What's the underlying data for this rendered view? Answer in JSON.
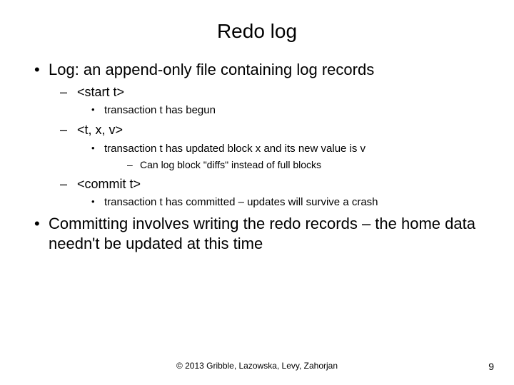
{
  "title": "Redo log",
  "bullets": {
    "b1": "Log:  an append-only file containing log records",
    "b1a": "<start t>",
    "b1a1": "transaction t has begun",
    "b1b": "<t, x, v>",
    "b1b1": "transaction t has updated block x and its new value is v",
    "b1b1a": "Can log block \"diffs\" instead of full blocks",
    "b1c": "<commit t>",
    "b1c1": "transaction t has committed – updates will survive a crash",
    "b2": "Committing involves writing the redo records – the home data needn't be updated at this time"
  },
  "footer": "© 2013 Gribble, Lazowska, Levy, Zahorjan",
  "page_number": "9"
}
